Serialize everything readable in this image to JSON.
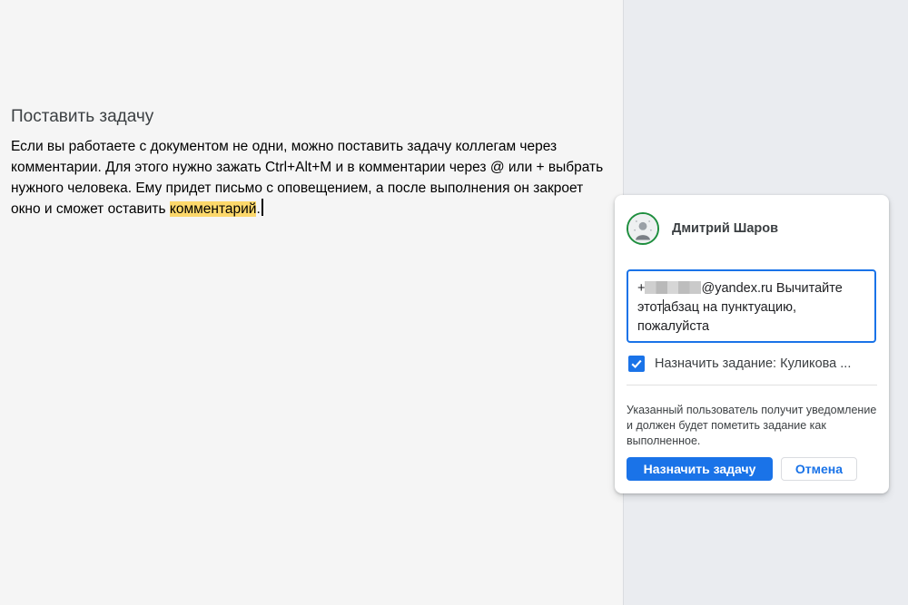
{
  "document": {
    "heading": "Поставить задачу",
    "paragraph_before": "Если вы работаете с документом не одни, можно поставить задачу коллегам через комментарии. Для этого нужно зажать Ctrl+Alt+M и в комментарии через @ или + выбрать нужного человека. Ему придет письмо с оповещением, а после выполнения он закроет окно и сможет оставить ",
    "paragraph_highlight": "комментарий",
    "paragraph_after": ".",
    "highlight_color": "#fcd86b"
  },
  "comment": {
    "author_name": "Дмитрий Шаров",
    "avatar_icon": "user-avatar-icon",
    "input_prefix": "+",
    "input_email_suffix": "@yandex.ru Вычитайте",
    "input_line2_part1": "этот",
    "input_line2_part2": "абзац на пунктуацию,",
    "input_line3": "пожалуйста",
    "assign_checked": true,
    "assign_label": "Назначить задание: Куликова ...",
    "info_text": "Указанный пользователь получит уведомление и должен будет пометить задание как выполненное.",
    "assign_button": "Назначить задачу",
    "cancel_button": "Отмена",
    "accent_color": "#1a73e8"
  }
}
